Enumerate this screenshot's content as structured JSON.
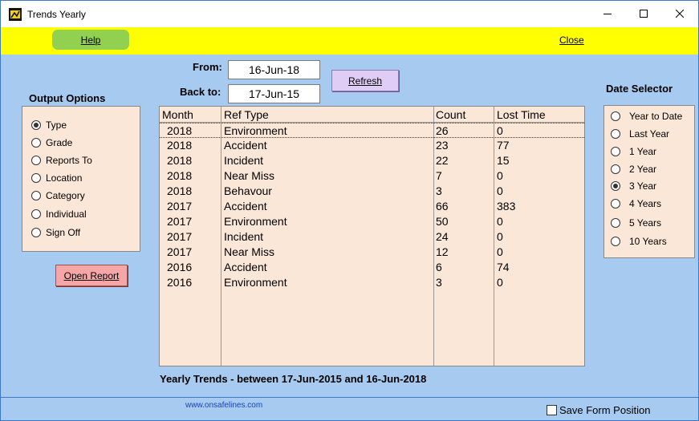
{
  "window": {
    "title": "Trends Yearly"
  },
  "menubar": {
    "help_label": "Help",
    "close_label": "Close"
  },
  "dates": {
    "from_label": "From:",
    "from_value": "16-Jun-18",
    "back_label": "Back to:",
    "back_value": "17-Jun-15",
    "refresh_label": "Refresh"
  },
  "output_options": {
    "title": "Output Options",
    "items": [
      {
        "label": "Type",
        "selected": true
      },
      {
        "label": "Grade",
        "selected": false
      },
      {
        "label": "Reports To",
        "selected": false
      },
      {
        "label": "Location",
        "selected": false
      },
      {
        "label": "Category",
        "selected": false
      },
      {
        "label": "Individual",
        "selected": false
      },
      {
        "label": "Sign Off",
        "selected": false
      }
    ]
  },
  "open_report_label": "Open Report",
  "date_selector": {
    "title": "Date Selector",
    "items": [
      {
        "label": "Year to Date",
        "selected": false
      },
      {
        "label": "Last Year",
        "selected": false
      },
      {
        "label": "1 Year",
        "selected": false
      },
      {
        "label": "2 Year",
        "selected": false
      },
      {
        "label": "3 Year",
        "selected": true
      },
      {
        "label": "4 Years",
        "selected": false
      },
      {
        "label": "5 Years",
        "selected": false
      },
      {
        "label": "10 Years",
        "selected": false
      }
    ]
  },
  "table": {
    "headers": [
      "Month",
      "Ref Type",
      "Count",
      "Lost Time"
    ],
    "rows": [
      [
        "2018",
        "Environment",
        "26",
        "0"
      ],
      [
        "2018",
        "Accident",
        "23",
        "77"
      ],
      [
        "2018",
        "Incident",
        "22",
        "15"
      ],
      [
        "2018",
        "Near Miss",
        "7",
        "0"
      ],
      [
        "2018",
        "Behavour",
        "3",
        "0"
      ],
      [
        "2017",
        "Accident",
        "66",
        "383"
      ],
      [
        "2017",
        "Environment",
        "50",
        "0"
      ],
      [
        "2017",
        "Incident",
        "24",
        "0"
      ],
      [
        "2017",
        "Near Miss",
        "12",
        "0"
      ],
      [
        "2016",
        "Accident",
        "6",
        "74"
      ],
      [
        "2016",
        "Environment",
        "3",
        "0"
      ]
    ]
  },
  "summary": "Yearly Trends - between 17-Jun-2015 and 16-Jun-2018",
  "footer": {
    "website": "www.onsafelines.com",
    "save_position_label": "Save Form Position"
  }
}
